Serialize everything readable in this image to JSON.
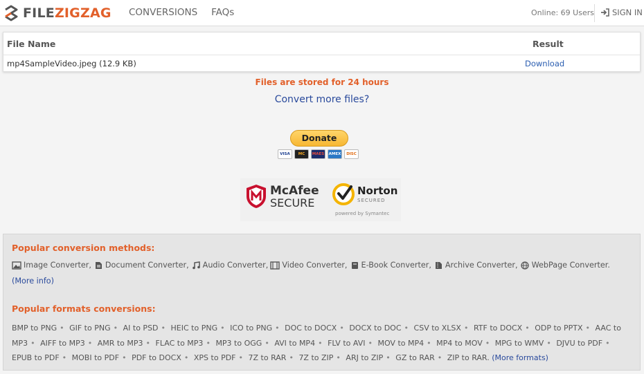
{
  "header": {
    "logo_file": "FILE",
    "logo_zigzag": "ZIGZAG",
    "nav": [
      "CONVERSIONS",
      "FAQs"
    ],
    "online": "Online: 69 Users",
    "signin": "SIGN IN"
  },
  "results": {
    "col_name": "File Name",
    "col_result": "Result",
    "file_name": "mp4SampleVideo.jpeg (12.9 KB)",
    "result_link": "Download"
  },
  "stored_notice": "Files are stored for 24 hours",
  "convert_more": "Convert more files?",
  "donate": {
    "label": "Donate",
    "cards": [
      "VISA",
      "MC",
      "MAES",
      "AMEX",
      "DISC"
    ]
  },
  "badges": {
    "mcafee_name": "McAfee",
    "mcafee_secure": "SECURE",
    "norton_name": "Norton",
    "norton_secured": "SECURED",
    "norton_powered": "powered by Symantec"
  },
  "panel": {
    "methods_title": "Popular conversion methods:",
    "methods": [
      {
        "label": "Image Converter,",
        "icon": "image-icon"
      },
      {
        "label": "Document Converter,",
        "icon": "document-icon"
      },
      {
        "label": "Audio Converter,",
        "icon": "music-icon"
      },
      {
        "label": "Video Converter,",
        "icon": "film-icon"
      },
      {
        "label": "E-Book Converter,",
        "icon": "book-icon"
      },
      {
        "label": "Archive Converter,",
        "icon": "archive-icon"
      },
      {
        "label": "WebPage Converter.",
        "icon": "globe-icon"
      }
    ],
    "more_info": "(More info)",
    "formats_title": "Popular formats conversions:",
    "formats": [
      "BMP to PNG",
      "GIF to PNG",
      "AI to PSD",
      "HEIC to PNG",
      "ICO to PNG",
      "DOC to DOCX",
      "DOCX to DOC",
      "CSV to XLSX",
      "RTF to DOCX",
      "ODP to PPTX",
      "AAC to MP3",
      "AIFF to MP3",
      "AMR to MP3",
      "FLAC to MP3",
      "MP3 to OGG",
      "AVI to MP4",
      "FLV to AVI",
      "MOV to MP4",
      "MP4 to MOV",
      "MPG to WMV",
      "DJVU to PDF",
      "EPUB to PDF",
      "MOBI to PDF",
      "PDF to DOCX",
      "XPS to PDF",
      "7Z to RAR",
      "7Z to ZIP",
      "ARJ to ZIP",
      "GZ to RAR",
      "ZIP to RAR."
    ],
    "more_formats": "(More formats)"
  },
  "colors": {
    "accent": "#e2602a",
    "link": "#2a4a9c",
    "paypal_yellow": "#f7b733"
  }
}
